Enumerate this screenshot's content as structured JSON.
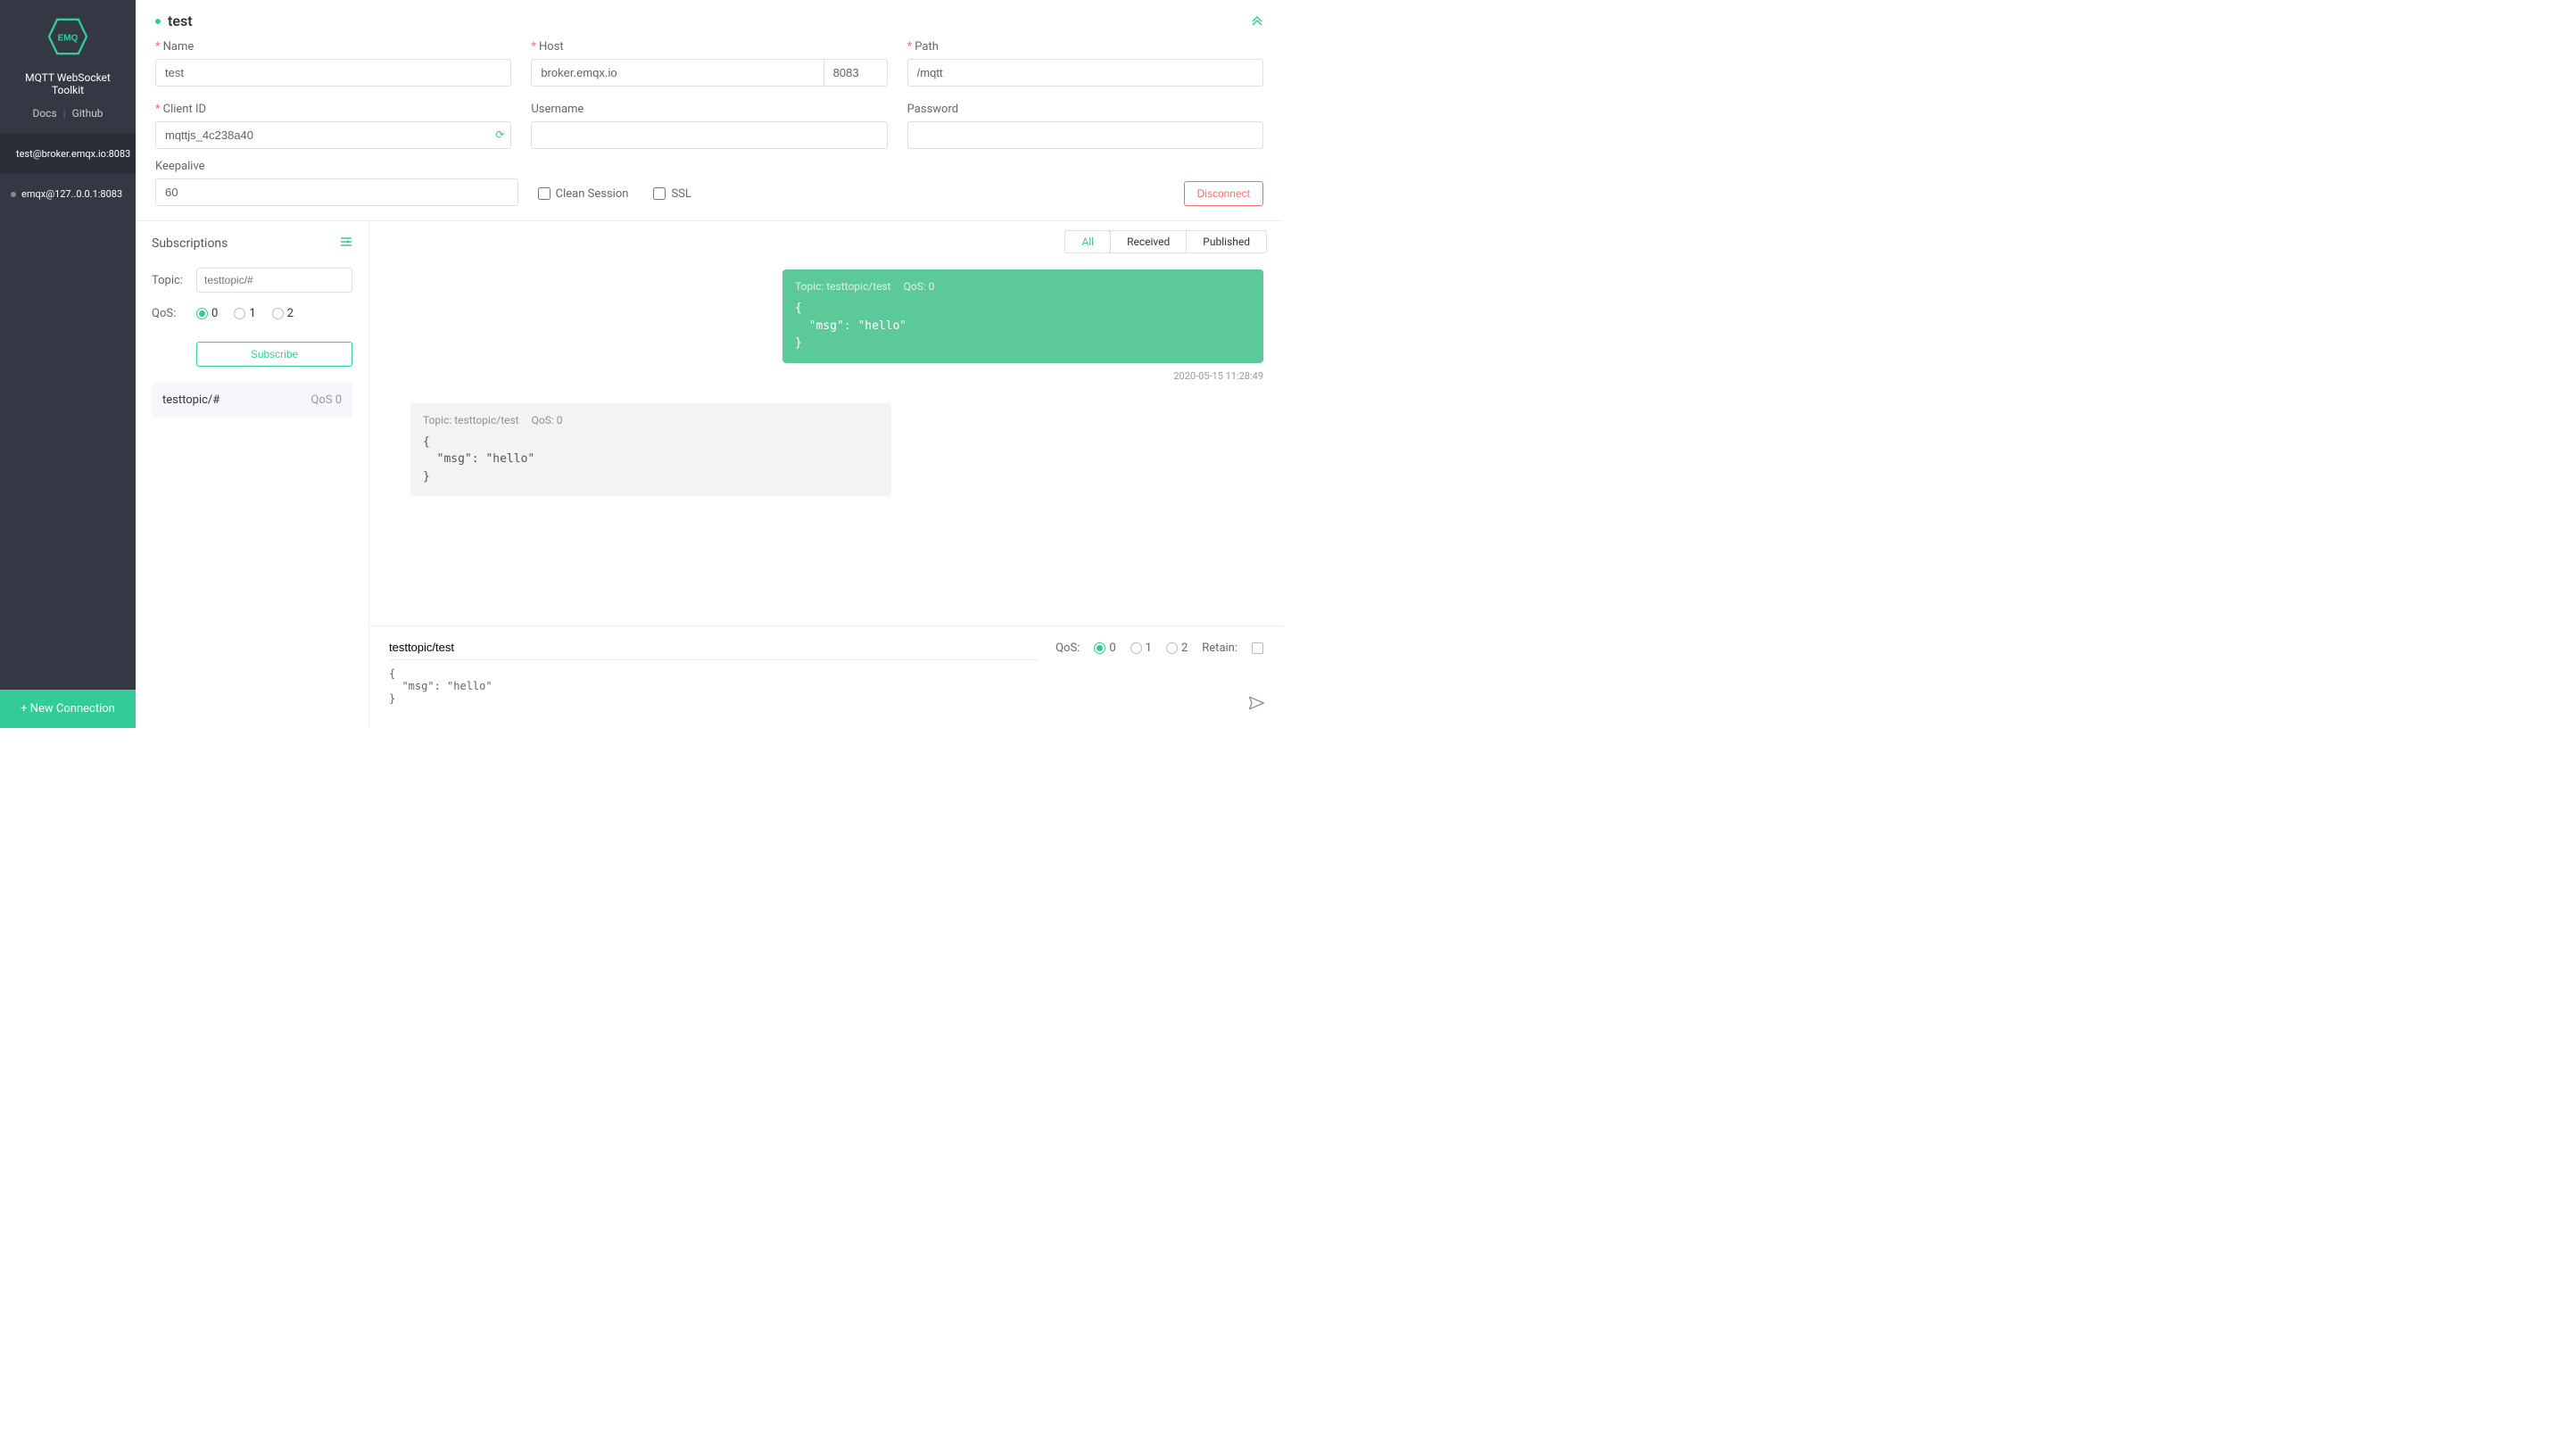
{
  "app": {
    "title": "MQTT WebSocket Toolkit",
    "nav": {
      "docs": "Docs",
      "github": "Github"
    }
  },
  "connections": [
    {
      "id": "c1",
      "label": "test@broker.emqx.io:8083",
      "status": "online",
      "active": true
    },
    {
      "id": "c2",
      "label": "emqx@127..0.0.1:8083",
      "status": "offline",
      "active": false
    }
  ],
  "new_connection_label": "+ New Connection",
  "config": {
    "title": "test",
    "fields": {
      "name": {
        "label": "Name",
        "value": "test",
        "required": true
      },
      "host": {
        "label": "Host",
        "value": "broker.emqx.io",
        "port": "8083",
        "required": true
      },
      "path": {
        "label": "Path",
        "value": "/mqtt",
        "required": true
      },
      "client_id": {
        "label": "Client ID",
        "value": "mqttjs_4c238a40",
        "required": true
      },
      "username": {
        "label": "Username",
        "value": ""
      },
      "password": {
        "label": "Password",
        "value": ""
      },
      "keepalive": {
        "label": "Keepalive",
        "value": "60"
      },
      "clean_session": {
        "label": "Clean Session",
        "checked": false
      },
      "ssl": {
        "label": "SSL",
        "checked": false
      }
    },
    "disconnect_label": "Disconnect"
  },
  "subscriptions": {
    "header": "Subscriptions",
    "topic_label": "Topic:",
    "topic_placeholder": "testtopic/#",
    "qos_label": "QoS:",
    "qos_options": [
      "0",
      "1",
      "2"
    ],
    "qos_selected": "0",
    "subscribe_label": "Subscribe",
    "items": [
      {
        "topic": "testtopic/#",
        "qos": "QoS 0"
      }
    ]
  },
  "messages": {
    "tabs": {
      "all": "All",
      "received": "Received",
      "published": "Published",
      "active": "all"
    },
    "items": [
      {
        "direction": "sent",
        "topic_label": "Topic: testtopic/test",
        "qos_label": "QoS: 0",
        "body": "{\n  \"msg\": \"hello\"\n}",
        "timestamp": "2020-05-15 11:28:49"
      },
      {
        "direction": "recv",
        "topic_label": "Topic: testtopic/test",
        "qos_label": "QoS: 0",
        "body": "{\n  \"msg\": \"hello\"\n}",
        "timestamp": ""
      }
    ]
  },
  "publish": {
    "topic": "testtopic/test",
    "qos_label": "QoS:",
    "qos_options": [
      "0",
      "1",
      "2"
    ],
    "qos_selected": "0",
    "retain_label": "Retain:",
    "body": "{\n  \"msg\": \"hello\"\n}"
  }
}
